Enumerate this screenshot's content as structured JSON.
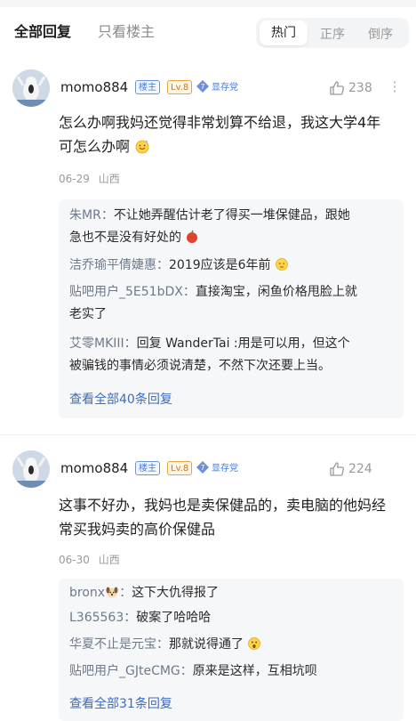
{
  "tabs": {
    "all": "全部回复",
    "owner_only": "只看楼主"
  },
  "sort": {
    "hot": "热门",
    "asc": "正序",
    "desc": "倒序"
  },
  "posts": [
    {
      "user": "momo884",
      "owner_badge": "楼主",
      "level": "Lv.8",
      "club_level": "7",
      "club": "显存党",
      "likes": "238",
      "content_line1": "怎么办啊我妈还觉得非常划算不给退，我这大学4年",
      "content_line2": "可怎么办啊",
      "emoji": "sweat-smile-emoji",
      "date": "06-29",
      "location": "山西",
      "replies": [
        {
          "name": "朱MR",
          "sep": "：",
          "text_line1": "不让她弄醒估计老了得买一堆保健品，跟她",
          "text_line2": "急也不是没有好处的",
          "emoji": "apple-emoji"
        },
        {
          "name": "洁乔瑜平倩婕惠",
          "sep": "：",
          "text_line1": "2019应该是6年前",
          "emoji": "thinking-emoji"
        },
        {
          "name": "贴吧用户_5E51bDX",
          "sep": "：",
          "text_line1": "直接淘宝，闲鱼价格甩脸上就",
          "text_line2": "老实了"
        },
        {
          "name": "艾零MKIII",
          "sep": "：",
          "text_line1": "回复 WanderTai :用是可以用，但这个",
          "text_line2": "被骗钱的事情必须说清楚，不然下次还要上当。"
        }
      ],
      "see_all": "查看全部40条回复"
    },
    {
      "user": "momo884",
      "owner_badge": "楼主",
      "level": "Lv.8",
      "club_level": "7",
      "club": "显存党",
      "likes": "224",
      "content_line1": "这事不好办，我妈也是卖保健品的，卖电脑的他妈经",
      "content_line2": "常买我妈卖的高价保健品",
      "date": "06-30",
      "location": "山西",
      "replies": [
        {
          "name": "bronx",
          "sep": "：",
          "text_line1": "这下大仇得报了",
          "name_emoji": "dog-emoji"
        },
        {
          "name": "L365563",
          "sep": "：",
          "text_line1": "破案了哈哈哈"
        },
        {
          "name": "华夏不止是元宝",
          "sep": "：",
          "text_line1": "那就说得通了",
          "emoji": "surprised-emoji"
        },
        {
          "name": "贴吧用户_GJteCMG",
          "sep": "：",
          "text_line1": "原来是这样，互相坑呗"
        }
      ],
      "see_all": "查看全部31条回复"
    }
  ]
}
